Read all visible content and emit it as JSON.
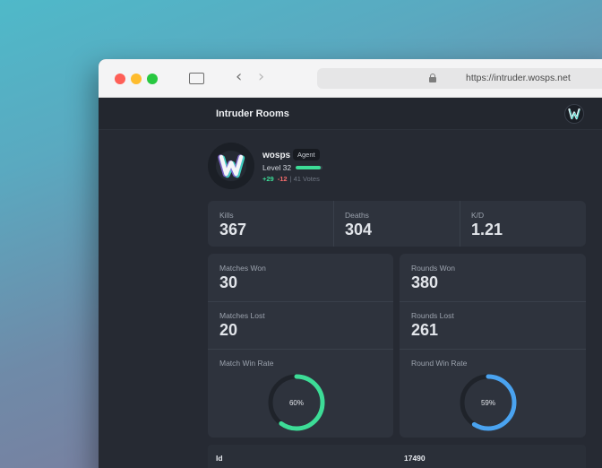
{
  "browser": {
    "url": "https://intruder.wosps.net"
  },
  "app": {
    "title": "Intruder Rooms",
    "logo_icon": "wosps-logo-icon"
  },
  "profile": {
    "username": "wosps",
    "role_badge": "Agent",
    "level": "Level 32",
    "level_progress": 0.92,
    "votes_up": "+29",
    "votes_down": "-12",
    "votes_separator": "|",
    "votes_total": "41 Votes"
  },
  "stats": {
    "kills": {
      "label": "Kills",
      "value": "367"
    },
    "deaths": {
      "label": "Deaths",
      "value": "304"
    },
    "kd": {
      "label": "K/D",
      "value": "1.21"
    }
  },
  "matches": {
    "won": {
      "label": "Matches Won",
      "value": "30"
    },
    "lost": {
      "label": "Matches Lost",
      "value": "20"
    },
    "win_rate": {
      "label": "Match Win Rate",
      "value": "60%",
      "fraction": 0.6,
      "color": "#3ddc97"
    }
  },
  "rounds": {
    "won": {
      "label": "Rounds Won",
      "value": "380"
    },
    "lost": {
      "label": "Rounds Lost",
      "value": "261"
    },
    "win_rate": {
      "label": "Round Win Rate",
      "value": "59%",
      "fraction": 0.59,
      "color": "#4aa3f0"
    }
  },
  "details_table": {
    "rows": [
      {
        "key": "Id",
        "value": "17490"
      }
    ]
  },
  "colors": {
    "accent_green": "#3ddc97",
    "accent_blue": "#4aa3f0",
    "vote_down": "#f26b6b",
    "ring_track": "#1f232a"
  }
}
